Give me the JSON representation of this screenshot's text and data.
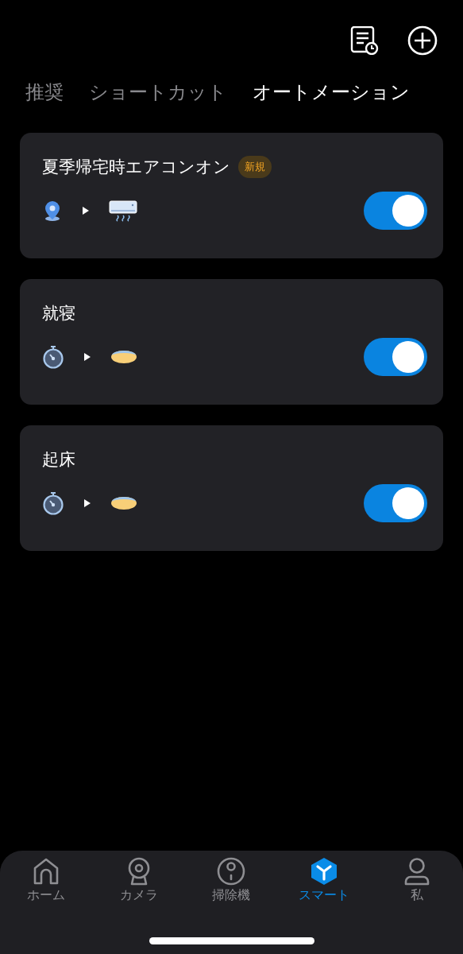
{
  "tabs": [
    {
      "label": "推奨",
      "selected": false
    },
    {
      "label": "ショートカット",
      "selected": false
    },
    {
      "label": "オートメーション",
      "selected": true
    }
  ],
  "automations": [
    {
      "name": "夏季帰宅時エアコンオン",
      "badge": "新規",
      "trigger": {
        "kind": "location"
      },
      "action": {
        "kind": "aircon"
      },
      "on": true
    },
    {
      "name": "就寝",
      "trigger": {
        "kind": "timer"
      },
      "action": {
        "kind": "light"
      },
      "on": true
    },
    {
      "name": "起床",
      "trigger": {
        "kind": "timer"
      },
      "action": {
        "kind": "light"
      },
      "on": true
    }
  ],
  "nav": [
    {
      "kind": "home",
      "label": "ホーム",
      "selected": false
    },
    {
      "kind": "camera",
      "label": "カメラ",
      "selected": false
    },
    {
      "kind": "vacuum",
      "label": "掃除機",
      "selected": false
    },
    {
      "kind": "smart",
      "label": "スマート",
      "selected": true
    },
    {
      "kind": "me",
      "label": "私",
      "selected": false
    }
  ]
}
